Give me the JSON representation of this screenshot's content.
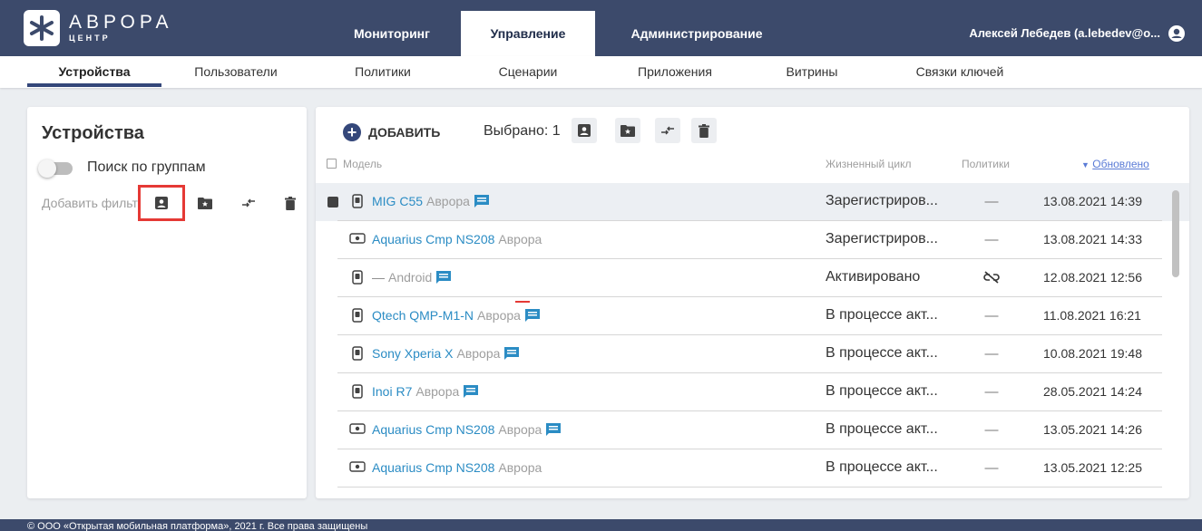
{
  "brand": {
    "name": "АВРОРА",
    "sub": "ЦЕНТР"
  },
  "main_tabs": [
    {
      "label": "Мониторинг"
    },
    {
      "label": "Управление"
    },
    {
      "label": "Администрирование"
    }
  ],
  "user": {
    "name": "Алексей Лебедев (a.lebedev@o..."
  },
  "sub_tabs": [
    {
      "label": "Устройства"
    },
    {
      "label": "Пользователи"
    },
    {
      "label": "Политики"
    },
    {
      "label": "Сценарии"
    },
    {
      "label": "Приложения"
    },
    {
      "label": "Витрины"
    },
    {
      "label": "Связки ключей"
    }
  ],
  "left": {
    "title": "Устройства",
    "toggle_label": "Поиск по группам",
    "filter_placeholder": "Добавить фильтр"
  },
  "toolbar": {
    "add_label": "ДОБАВИТЬ",
    "selected_label": "Выбрано: 1"
  },
  "table": {
    "headers": {
      "model": "Модель",
      "lifecycle": "Жизненный цикл",
      "policies": "Политики",
      "updated": "Обновлено"
    },
    "rows": [
      {
        "model": "MIG C55",
        "os": "Аврора",
        "lifecycle": "Зарегистриров...",
        "policy": "—",
        "updated": "13.08.2021 14:39"
      },
      {
        "model": "Aquarius Cmp NS208",
        "os": "Аврора",
        "lifecycle": "Зарегистриров...",
        "policy": "—",
        "updated": "13.08.2021 14:33"
      },
      {
        "model": "—",
        "os": "Android",
        "lifecycle": "Активировано",
        "policy": "",
        "updated": "12.08.2021 12:56"
      },
      {
        "model": "Qtech QMP-M1-N",
        "os": "Аврора",
        "lifecycle": "В процессе акт...",
        "policy": "—",
        "updated": "11.08.2021 16:21"
      },
      {
        "model": "Sony Xperia X",
        "os": "Аврора",
        "lifecycle": "В процессе акт...",
        "policy": "—",
        "updated": "10.08.2021 19:48"
      },
      {
        "model": "Inoi R7",
        "os": "Аврора",
        "lifecycle": "В процессе акт...",
        "policy": "—",
        "updated": "28.05.2021 14:24"
      },
      {
        "model": "Aquarius Cmp NS208",
        "os": "Аврора",
        "lifecycle": "В процессе акт...",
        "policy": "—",
        "updated": "13.05.2021 14:26"
      },
      {
        "model": "Aquarius Cmp NS208",
        "os": "Аврора",
        "lifecycle": "В процессе акт...",
        "policy": "—",
        "updated": "13.05.2021 12:25"
      }
    ]
  },
  "footer": {
    "text": "© ООО «Открытая мобильная платформа», 2021 г. Все права защищены"
  },
  "colors": {
    "header_bg": "#3c4a6b",
    "link": "#2b8cc4",
    "highlight": "#e53935"
  }
}
